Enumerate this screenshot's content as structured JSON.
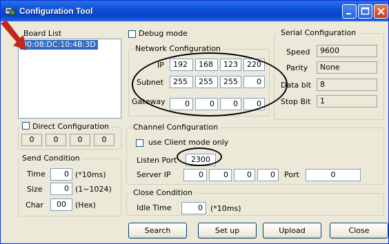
{
  "window": {
    "title": "Configuration Tool"
  },
  "board_list": {
    "header": "Board List",
    "items": [
      "00:08:DC:10:4B:3D"
    ]
  },
  "debug_mode_label": "Debug mode",
  "network": {
    "legend": "Network Configuration",
    "ip_label": "IP",
    "ip": [
      "192",
      "168",
      "123",
      "220"
    ],
    "subnet_label": "Subnet",
    "subnet": [
      "255",
      "255",
      "255",
      "0"
    ],
    "gateway_label": "Gateway",
    "gateway": [
      "0",
      "0",
      "0",
      "0"
    ]
  },
  "serial": {
    "legend": "Serial Configuration",
    "speed_label": "Speed",
    "speed": "9600",
    "parity_label": "Parity",
    "parity": "None",
    "databit_label": "Data bit",
    "databit": "8",
    "stopbit_label": "Stop Bit",
    "stopbit": "1"
  },
  "direct": {
    "legend": "Direct Configuration",
    "values": [
      "0",
      "0",
      "0",
      "0"
    ]
  },
  "channel": {
    "legend": "Channel Configuration",
    "client_mode_label": "use Client mode only",
    "listen_port_label": "Listen Port",
    "listen_port": "2300",
    "server_ip_label": "Server IP",
    "server_ip": [
      "0",
      "0",
      "0",
      "0"
    ],
    "port_label": "Port",
    "port": "0"
  },
  "send": {
    "legend": "Send Condition",
    "time_label": "Time",
    "time": "0",
    "time_unit": "(*10ms)",
    "size_label": "Size",
    "size": "0",
    "size_unit": "(1~1024)",
    "char_label": "Char",
    "char": "00",
    "char_unit": "(Hex)"
  },
  "close_cond": {
    "legend": "Close Condition",
    "idle_label": "Idle Time",
    "idle": "0",
    "idle_unit": "(*10ms)"
  },
  "buttons": {
    "search": "Search",
    "setup": "Set up",
    "upload": "Upload",
    "close": "Close"
  },
  "colors": {
    "titlebar": "#0a4fd6",
    "selection": "#316ac5",
    "annotation_arrow": "#c0281c"
  }
}
